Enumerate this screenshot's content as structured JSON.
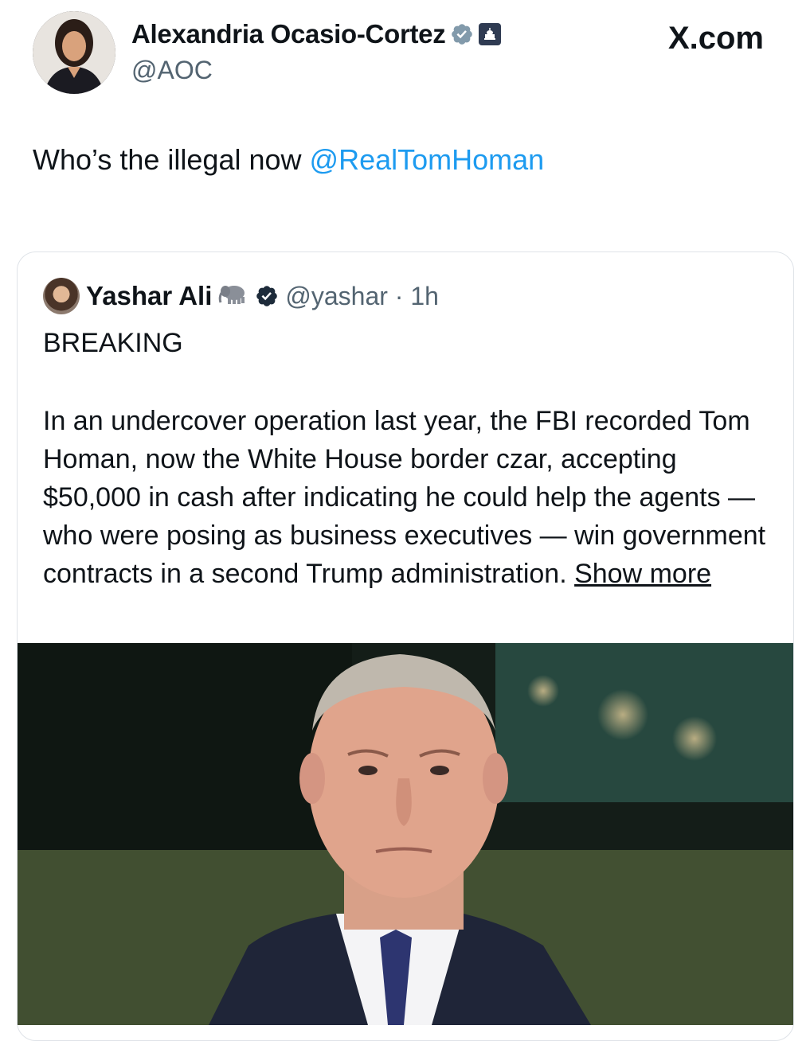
{
  "header": {
    "display_name": "Alexandria Ocasio-Cortez",
    "handle": "@AOC",
    "site": "X.com"
  },
  "tweet": {
    "text": "Who’s the illegal now ",
    "mention": "@RealTomHoman"
  },
  "quote": {
    "name": "Yashar Ali",
    "handle_time": "@yashar · 1h",
    "breaking": "BREAKING",
    "body": "In an undercover operation last year, the FBI recorded Tom Homan, now the White House border czar, accepting $50,000 in cash after indicating he could help the agents — who were posing as business executives — win government contracts in a second Trump administration. ",
    "show_more": "Show more"
  },
  "icons": {
    "verified_gray": "verified-badge-gray",
    "government": "capitol-icon",
    "verified_blue": "verified-badge-blue",
    "elephant": "elephant-icon"
  },
  "colors": {
    "link": "#1d9bf0",
    "verified": "#1d9bf0",
    "muted": "#536471"
  }
}
